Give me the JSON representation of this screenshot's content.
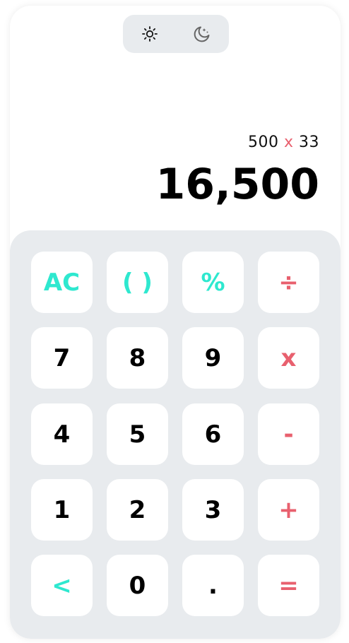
{
  "theme_toggle": {
    "light_icon": "sun-icon",
    "dark_icon": "moon-icon"
  },
  "display": {
    "operand1": "500",
    "operator": "x",
    "operand2": "33",
    "result": "16,500"
  },
  "keys": {
    "ac": "AC",
    "parens": "( )",
    "percent": "%",
    "divide": "÷",
    "seven": "7",
    "eight": "8",
    "nine": "9",
    "multiply": "x",
    "four": "4",
    "five": "5",
    "six": "6",
    "minus": "-",
    "one": "1",
    "two": "2",
    "three": "3",
    "plus": "+",
    "backspace": "<",
    "zero": "0",
    "decimal": ".",
    "equals": "="
  },
  "colors": {
    "function_key": "#2ee8cf",
    "operator_key": "#e8606e",
    "keypad_bg": "#e8ebee"
  }
}
